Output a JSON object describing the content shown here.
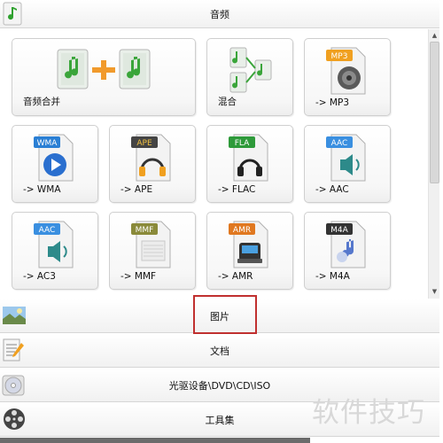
{
  "sections": {
    "audio": {
      "label": "音频"
    },
    "picture": {
      "label": "图片"
    },
    "document": {
      "label": "文档"
    },
    "disc": {
      "label": "光驱设备\\DVD\\CD\\ISO"
    },
    "tools": {
      "label": "工具集"
    }
  },
  "tiles": [
    {
      "label": "音频合并",
      "badge": ""
    },
    {
      "label": "混合",
      "badge": ""
    },
    {
      "label": "-> MP3",
      "badge": "MP3"
    },
    {
      "label": "-> WMA",
      "badge": "WMA"
    },
    {
      "label": "-> APE",
      "badge": "APE"
    },
    {
      "label": "-> FLAC",
      "badge": "FLA"
    },
    {
      "label": "-> AAC",
      "badge": "AAC"
    },
    {
      "label": "-> AC3",
      "badge": "AAC"
    },
    {
      "label": "-> MMF",
      "badge": "MMF"
    },
    {
      "label": "-> AMR",
      "badge": "AMR"
    },
    {
      "label": "-> M4A",
      "badge": "M4A"
    }
  ],
  "watermark": "软件技巧",
  "colors": {
    "highlight": "#c0302f",
    "badge_mp3": "#f0a020",
    "badge_wma": "#2a7fd4",
    "badge_ape": "#444444",
    "badge_fla": "#2e9a3a",
    "badge_aac": "#3a8fe0",
    "badge_mmf": "#8a8a3a",
    "badge_amr": "#e07820",
    "badge_m4a": "#333333"
  }
}
